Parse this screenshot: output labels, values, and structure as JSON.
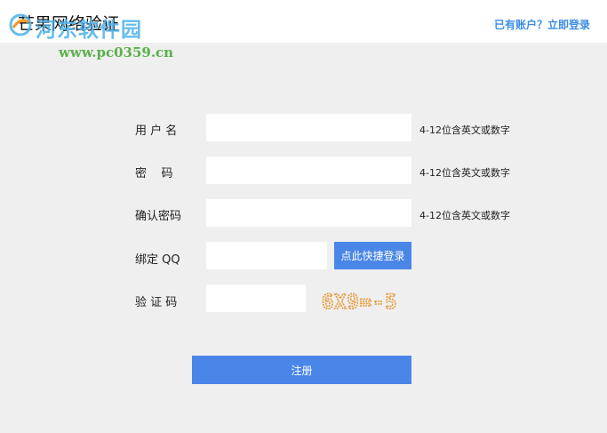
{
  "header": {
    "app_title": "芒果网络验证",
    "login_link": "已有账户？立即登录"
  },
  "watermark": {
    "text": "河东软件园",
    "url": "www.pc0359.cn"
  },
  "form": {
    "username": {
      "label": "用 户 名",
      "value": "",
      "hint": "4-12位含英文或数字"
    },
    "password": {
      "label": "密    码",
      "value": "",
      "hint": "4-12位含英文或数字"
    },
    "confirm_password": {
      "label": "确认密码",
      "value": "",
      "hint": "4-12位含英文或数字"
    },
    "bind_qq": {
      "label": "绑定 QQ",
      "value": "",
      "quick_login_button": "点此快捷登录"
    },
    "captcha": {
      "label": "验 证 码",
      "value": "",
      "image_text": "6X9=-5"
    },
    "register_button": "注册"
  },
  "colors": {
    "accent": "#4a86e8",
    "link": "#3c8de6",
    "background": "#efefef"
  }
}
